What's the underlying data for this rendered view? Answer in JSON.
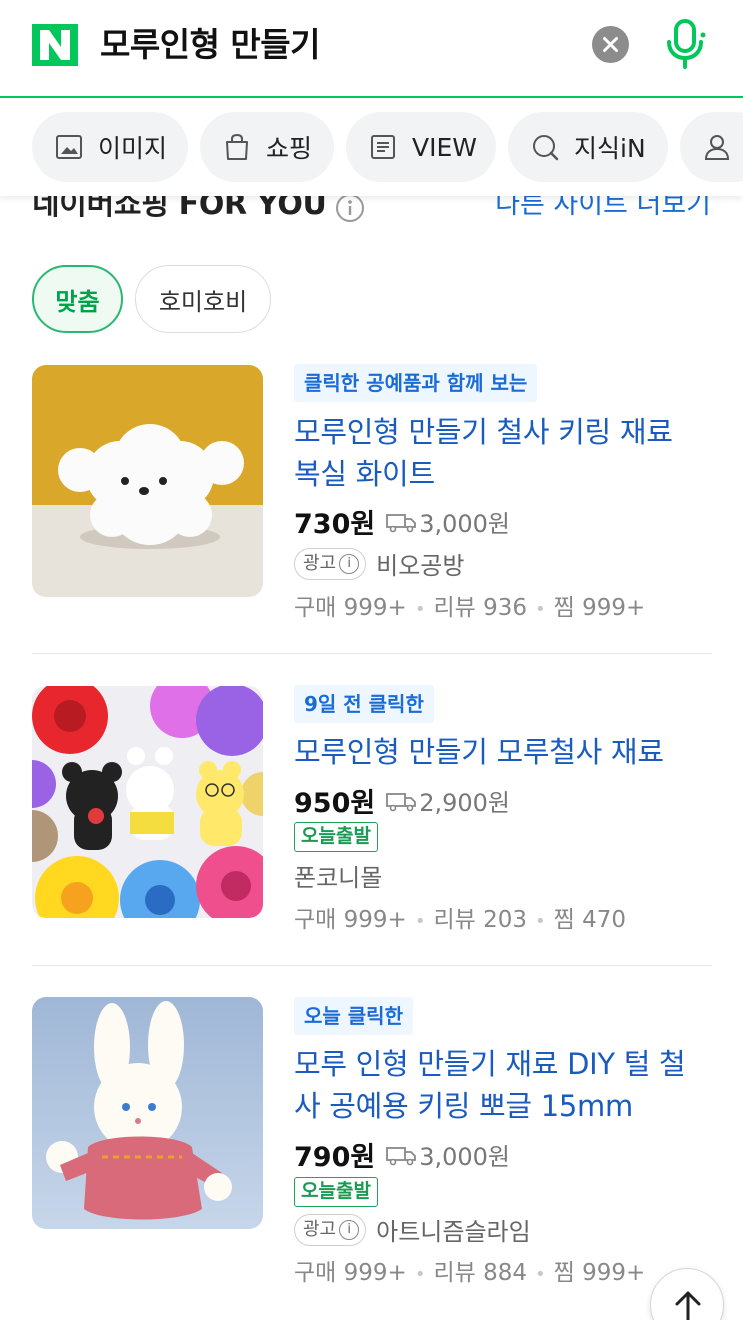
{
  "search": {
    "query": "모루인형 만들기"
  },
  "tabs": [
    {
      "label": "이미지",
      "icon": "image-icon"
    },
    {
      "label": "쇼핑",
      "icon": "shopping-bag-icon"
    },
    {
      "label": "VIEW",
      "icon": "document-icon"
    },
    {
      "label": "지식iN",
      "icon": "qna-icon"
    },
    {
      "label": "",
      "icon": "person-icon"
    }
  ],
  "section": {
    "title": "네이버쇼핑 FOR YOU",
    "more_link": "다른 사이트 더보기"
  },
  "filters": [
    {
      "label": "맞춤",
      "active": true
    },
    {
      "label": "호미호비",
      "active": false
    }
  ],
  "products": [
    {
      "tag": "클릭한 공예품과 함께 보는",
      "title": "모루인형 만들기 철사 키링 재료 복실 화이트",
      "price": "730원",
      "shipping": "3,000원",
      "ad_label": "광고",
      "seller": "비오공방",
      "purchases": "구매 999+",
      "reviews": "리뷰 936",
      "wishes": "찜 999+"
    },
    {
      "tag": "9일 전 클릭한",
      "title": "모루인형 만들기 모루철사 재료",
      "price": "950원",
      "shipping": "2,900원",
      "today_badge": "오늘출발",
      "seller": "폰코니몰",
      "purchases": "구매 999+",
      "reviews": "리뷰 203",
      "wishes": "찜 470"
    },
    {
      "tag": "오늘 클릭한",
      "title": "모루 인형 만들기 재료 DIY 털 철사 공예용 키링 뽀글 15mm",
      "price": "790원",
      "shipping": "3,000원",
      "today_badge": "오늘출발",
      "ad_label": "광고",
      "seller": "아트니즘슬라임",
      "purchases": "구매 999+",
      "reviews": "리뷰 884",
      "wishes": "찜 999+"
    }
  ],
  "colors": {
    "brand_green": "#03c75a",
    "link_blue": "#1a6bd6",
    "title_blue": "#1a5bbf"
  }
}
